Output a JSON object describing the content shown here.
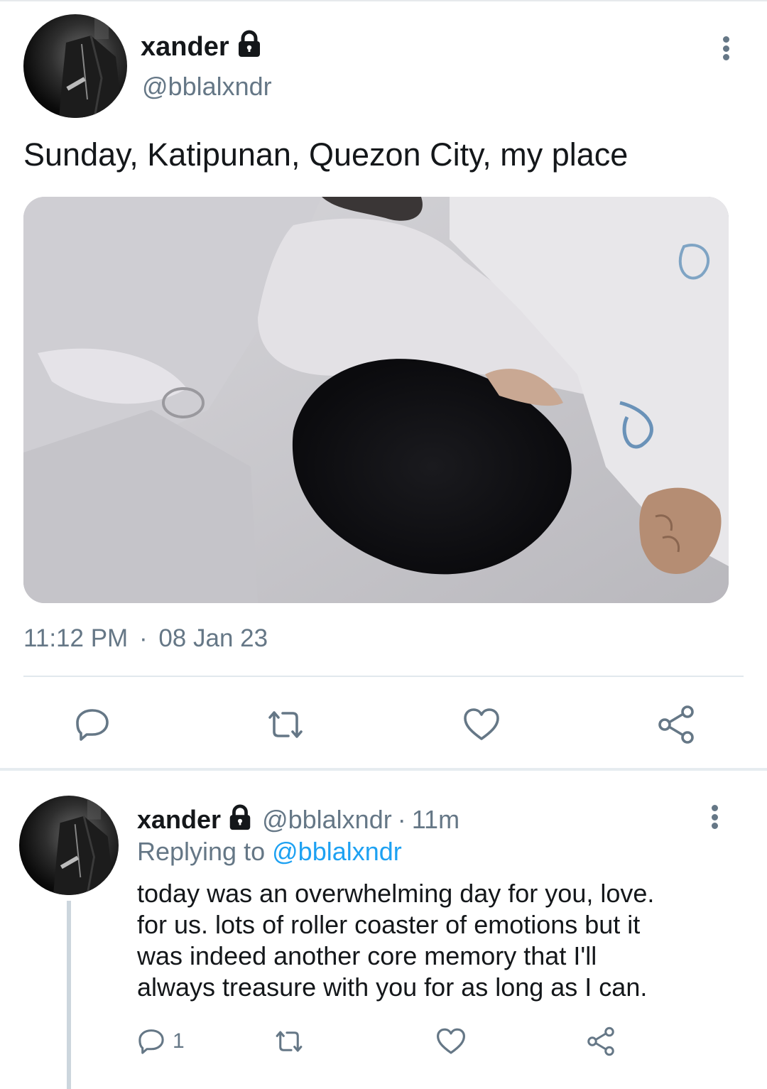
{
  "tweet": {
    "author_name": "xander",
    "author_handle": "@bblalxndr",
    "text": "Sunday, Katipunan, Quezon City, my place",
    "time": "11:12 PM",
    "dot": "·",
    "date": "08 Jan 23",
    "actions": [
      "comment-icon",
      "retweet-icon",
      "like-icon",
      "share-icon"
    ]
  },
  "reply": {
    "author_name": "xander",
    "author_handle": "@bblalxndr",
    "dot": "·",
    "age": "11m",
    "replying_prefix": "Replying to",
    "replying_handle": "@bblalxndr",
    "text_lines": [
      "today was an overwhelming day for you, love.",
      "for us. lots of roller coaster of emotions but it",
      "was indeed another core memory that I'll",
      "always treasure with you for as long as I can."
    ],
    "reply_count": "1"
  },
  "colors": {
    "text": "#14171a",
    "muted": "#657786",
    "link": "#1da1f2",
    "divider": "#e1e8ed"
  }
}
